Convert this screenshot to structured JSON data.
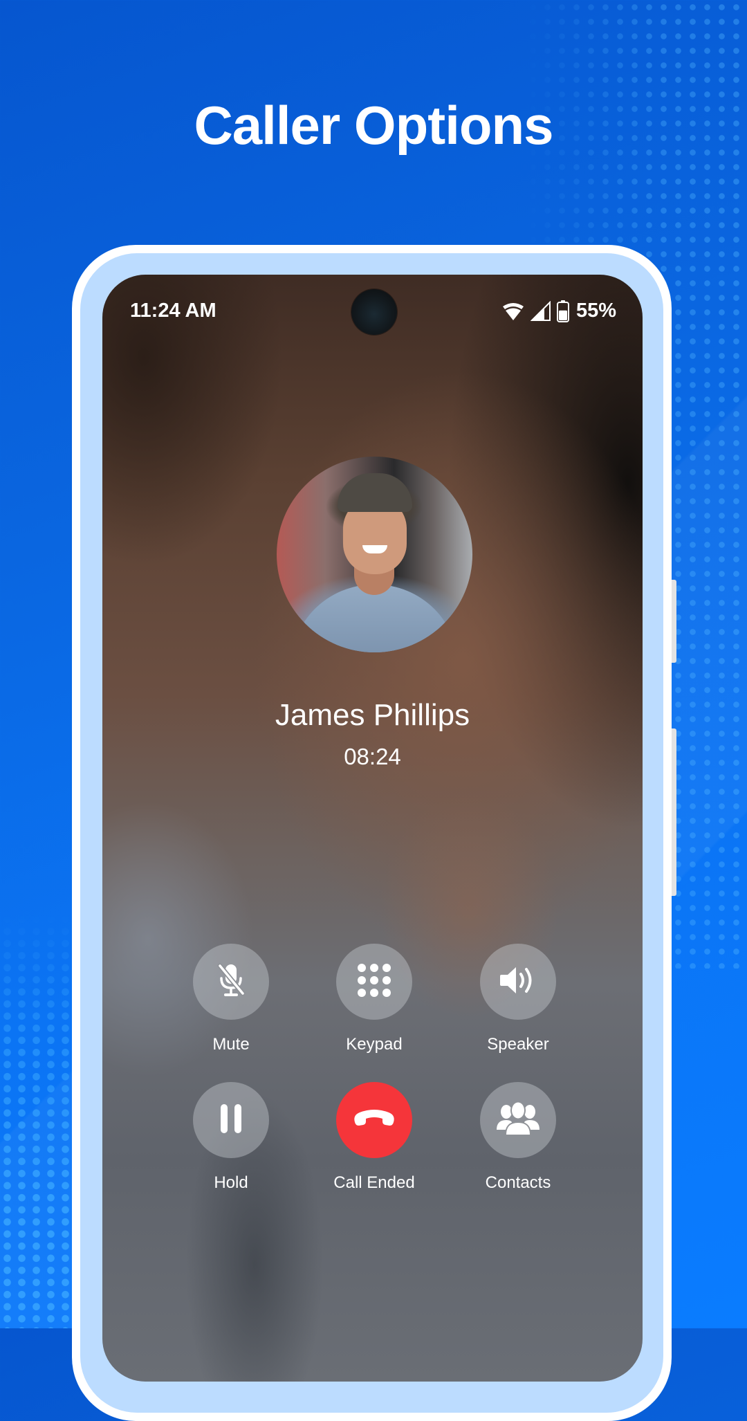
{
  "headline": "Caller Options",
  "status_bar": {
    "time": "11:24 AM",
    "wifi_icon": "wifi-icon",
    "signal_icon": "cell-signal-icon",
    "battery_icon": "battery-icon",
    "battery_percent": "55%",
    "battery_level": 0.55
  },
  "call": {
    "caller_name": "James Phillips",
    "duration": "08:24",
    "avatar_icon": "caller-photo"
  },
  "controls": [
    {
      "id": "mute",
      "label": "Mute",
      "icon": "mic-off-icon"
    },
    {
      "id": "keypad",
      "label": "Keypad",
      "icon": "keypad-icon"
    },
    {
      "id": "speaker",
      "label": "Speaker",
      "icon": "speaker-icon"
    },
    {
      "id": "hold",
      "label": "Hold",
      "icon": "pause-icon"
    },
    {
      "id": "end-call",
      "label": "Call Ended",
      "icon": "hang-up-icon"
    },
    {
      "id": "contacts",
      "label": "Contacts",
      "icon": "contacts-icon"
    }
  ],
  "colors": {
    "background_blue": "#0a6fe8",
    "end_call_red": "#f5353a",
    "phone_bezel": "#bcdcff"
  }
}
